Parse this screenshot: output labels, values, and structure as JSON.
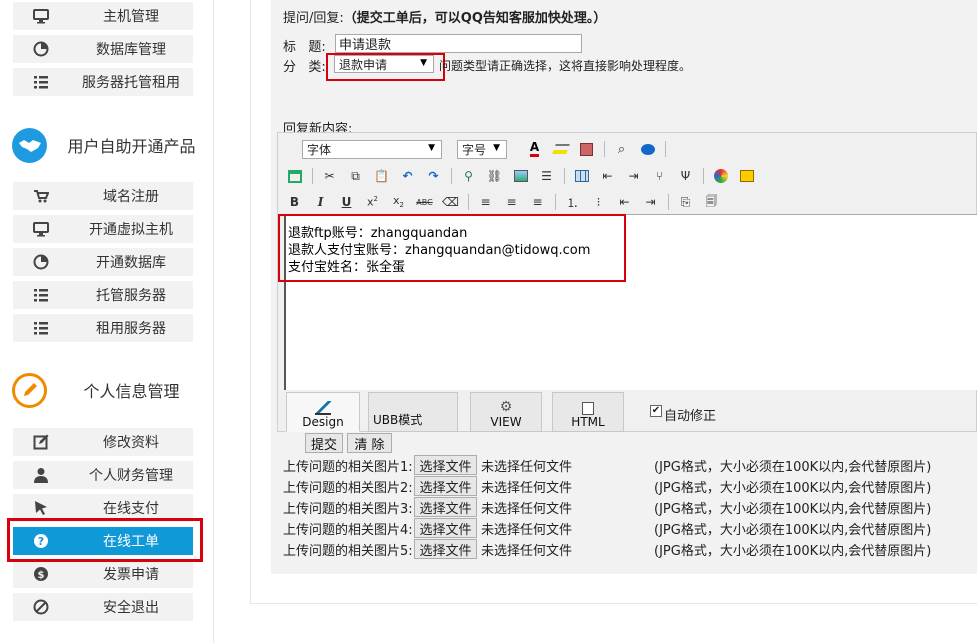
{
  "sidebar": {
    "top_items": [
      {
        "label": "主机管理",
        "icon": "monitor-icon"
      },
      {
        "label": "数据库管理",
        "icon": "pie-icon"
      },
      {
        "label": "服务器托管租用",
        "icon": "list-icon"
      }
    ],
    "group1_title": "用户自助开通产品",
    "group1_items": [
      {
        "label": "域名注册",
        "icon": "cart-icon"
      },
      {
        "label": "开通虚拟主机",
        "icon": "monitor-icon"
      },
      {
        "label": "开通数据库",
        "icon": "pie-icon"
      },
      {
        "label": "托管服务器",
        "icon": "list-icon"
      },
      {
        "label": "租用服务器",
        "icon": "list-icon"
      }
    ],
    "group2_title": "个人信息管理",
    "group2_items": [
      {
        "label": "修改资料",
        "icon": "edit-icon"
      },
      {
        "label": "个人财务管理",
        "icon": "user-icon"
      },
      {
        "label": "在线支付",
        "icon": "cursor-icon"
      },
      {
        "label": "在线工单",
        "icon": "question-icon"
      },
      {
        "label": "发票申请",
        "icon": "dollar-icon"
      },
      {
        "label": "安全退出",
        "icon": "ban-icon"
      }
    ]
  },
  "ticket": {
    "header_prefix": "提问/回复:",
    "header_notice": "（提交工单后，可以QQ告知客服加快处理。）",
    "title_label": "标   题:",
    "title_value": "申请退款",
    "category_label": "分   类:",
    "category_value": "退款申请",
    "category_hint": "问题类型请正确选择，这将直接影响处理程度。",
    "reply_label": "回复新内容:"
  },
  "editor": {
    "font_select": "字体",
    "size_select": "字号",
    "content_lines": [
      "退款ftp账号：zhangquandan",
      "退款人支付宝账号：zhangquandan@tidowq.com",
      "支付宝姓名：张全蛋"
    ],
    "modes": [
      {
        "label": "Design"
      },
      {
        "label": "UBB模式"
      },
      {
        "label": "VIEW"
      },
      {
        "label": "HTML"
      }
    ],
    "auto_fix_label": "自动修正"
  },
  "actions": {
    "submit": "提交",
    "clear": "清 除"
  },
  "uploads": [
    {
      "label": "上传问题的相关图片1:",
      "button": "选择文件",
      "status": "未选择任何文件",
      "note": "(JPG格式，大小必须在100K以内,会代替原图片)"
    },
    {
      "label": "上传问题的相关图片2:",
      "button": "选择文件",
      "status": "未选择任何文件",
      "note": "(JPG格式，大小必须在100K以内,会代替原图片)"
    },
    {
      "label": "上传问题的相关图片3:",
      "button": "选择文件",
      "status": "未选择任何文件",
      "note": "(JPG格式，大小必须在100K以内,会代替原图片)"
    },
    {
      "label": "上传问题的相关图片4:",
      "button": "选择文件",
      "status": "未选择任何文件",
      "note": "(JPG格式，大小必须在100K以内,会代替原图片)"
    },
    {
      "label": "上传问题的相关图片5:",
      "button": "选择文件",
      "status": "未选择任何文件",
      "note": "(JPG格式，大小必须在100K以内,会代替原图片)"
    }
  ],
  "colors": {
    "active_nav": "#0f99d6",
    "highlight": "#d9000d",
    "group1_icon": "#1e9be0",
    "group2_icon": "#f08b00"
  }
}
